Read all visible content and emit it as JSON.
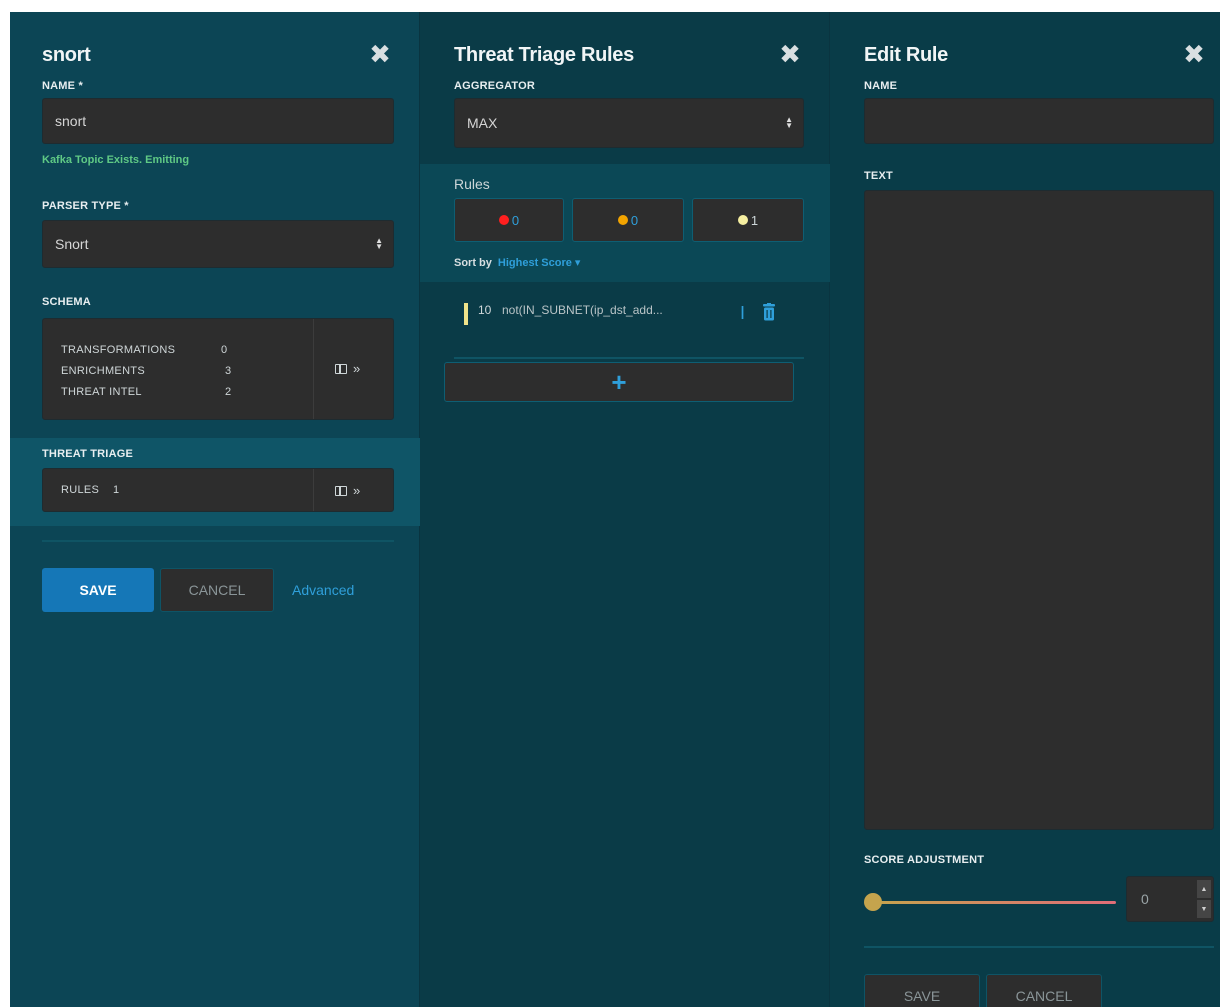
{
  "parser_panel": {
    "title": "snort",
    "name_label": "NAME *",
    "name_value": "snort",
    "kafka_status": "Kafka Topic Exists. Emitting",
    "parser_type_label": "PARSER TYPE *",
    "parser_type_value": "Snort",
    "schema_label": "SCHEMA",
    "schema": [
      {
        "key": "TRANSFORMATIONS",
        "value": "0"
      },
      {
        "key": "ENRICHMENTS",
        "value": "3"
      },
      {
        "key": "THREAT INTEL",
        "value": "2"
      }
    ],
    "threat_triage_label": "THREAT TRIAGE",
    "rules_key": "RULES",
    "rules_value": "1",
    "expand_glyph": "»",
    "save_label": "SAVE",
    "cancel_label": "CANCEL",
    "advanced_label": "Advanced"
  },
  "triage_panel": {
    "title": "Threat Triage Rules",
    "aggregator_label": "AGGREGATOR",
    "aggregator_value": "MAX",
    "rules_label": "Rules",
    "score_filters": [
      {
        "color": "#ff1f1f",
        "count": "0"
      },
      {
        "color": "#f2a400",
        "count": "0"
      },
      {
        "color": "#f5eea0",
        "count": "1"
      }
    ],
    "sort_by_label": "Sort by",
    "sort_by_value": "Highest Score ▾",
    "rules": [
      {
        "score": "10",
        "text": "not(IN_SUBNET(ip_dst_add...",
        "bar_color": "#efe38a"
      }
    ],
    "add_glyph": "+"
  },
  "edit_panel": {
    "title": "Edit Rule",
    "name_label": "NAME",
    "name_value": "",
    "text_label": "TEXT",
    "score_label": "SCORE ADJUSTMENT",
    "score_value": "0",
    "score_fraction": 0,
    "save_label": "SAVE",
    "cancel_label": "CANCEL"
  },
  "icons": {
    "close": "close-icon",
    "select": "select-arrows-icon",
    "columns": "columns-icon",
    "edit": "text-cursor-icon",
    "delete": "trash-icon",
    "add": "plus-icon"
  },
  "colors": {
    "panel_bg": "#0c4555",
    "highlight_band": "#0f5567",
    "input_bg": "#2d2d2d",
    "accent_blue": "#2f9fda",
    "primary_button": "#1577b7",
    "success_text": "#5fc985"
  }
}
